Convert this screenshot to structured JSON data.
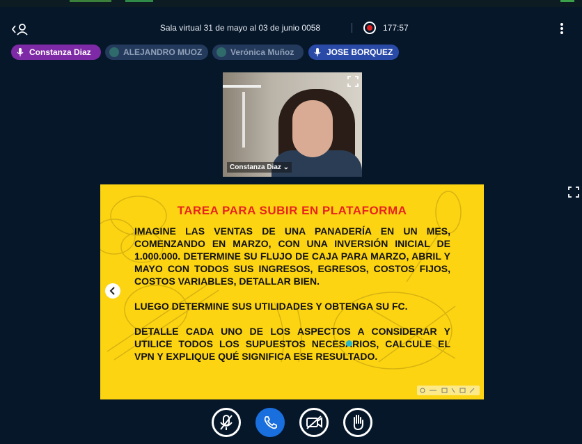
{
  "header": {
    "title": "Sala virtual 31 de mayo al 03 de junio 0058",
    "timer": "177:57"
  },
  "participants": [
    {
      "name": "Constanza Diaz",
      "state": "talking"
    },
    {
      "name": "ALEJANDRO MUOZ",
      "state": "muted"
    },
    {
      "name": "Verónica Muñoz",
      "state": "muted"
    },
    {
      "name": "JOSE BORQUEZ",
      "state": "talking"
    }
  ],
  "video": {
    "label": "Constanza Diaz ⌄"
  },
  "slide": {
    "title": "TAREA PARA SUBIR EN PLATAFORMA",
    "paragraphs": [
      "IMAGINE LAS VENTAS DE UNA PANADERÍA EN UN MES, COMENZANDO EN MARZO, CON UNA INVERSIÓN INICIAL DE 1.000.000. DETERMINE SU FLUJO DE CAJA PARA MARZO, ABRIL Y MAYO CON TODOS SUS INGRESOS, EGRESOS, COSTOS FIJOS, COSTOS VARIABLES, DETALLAR BIEN.",
      "LUEGO DETERMINE SUS UTILIDADES Y OBTENGA SU FC.",
      "DETALLE CADA UNO DE LOS ASPECTOS A CONSIDERAR Y UTILICE TODOS LOS SUPUESTOS NECESARIOS, CALCULE EL VPN Y EXPLIQUE QUÉ SIGNIFICA ESE RESULTADO."
    ]
  },
  "colors": {
    "background": "#06172a",
    "slide": "#fcd412",
    "slide_title": "#e8231e",
    "talking_chip": "#7e2aa6",
    "muted_chip": "#243a5c",
    "blue_chip": "#2a4aa8",
    "call_button": "#1a6fde",
    "record": "#e02020"
  },
  "icons": {
    "user": "user-list-icon",
    "record": "record-icon",
    "menu": "more-vertical-icon",
    "mic": "microphone-icon",
    "expand": "fullscreen-icon",
    "prev": "chevron-left-icon",
    "mute": "microphone-off-icon",
    "call": "phone-icon",
    "camera": "camera-off-icon",
    "hand": "raise-hand-icon"
  }
}
